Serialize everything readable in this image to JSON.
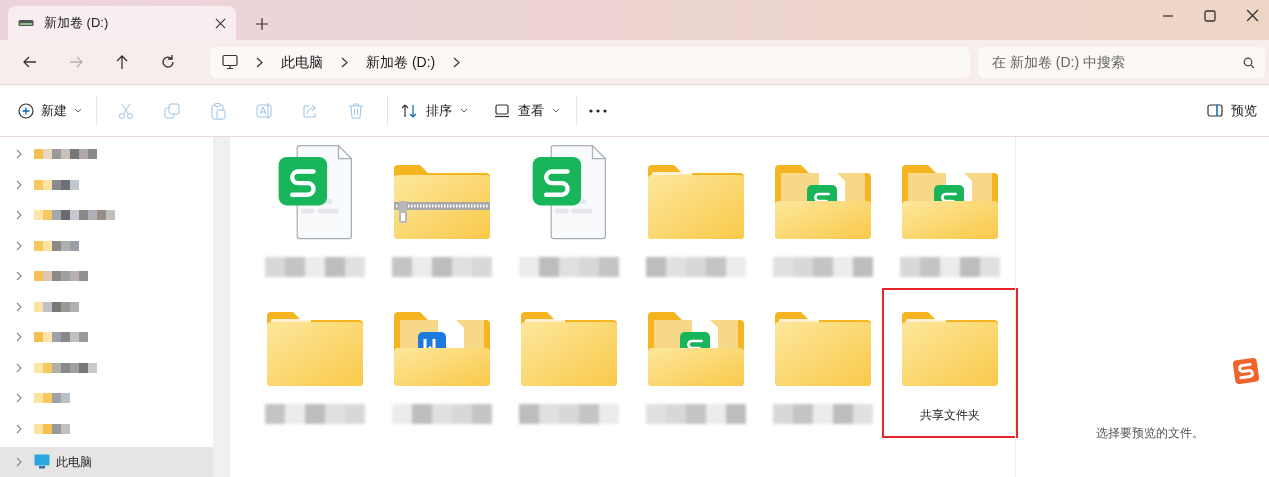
{
  "tab": {
    "title": "新加卷 (D:)"
  },
  "nav_buttons": [
    {
      "kind": "back",
      "disabled": false
    },
    {
      "kind": "forward",
      "disabled": true
    },
    {
      "kind": "up",
      "disabled": false
    },
    {
      "kind": "refresh",
      "disabled": false
    }
  ],
  "address": {
    "crumbs": [
      "此电脑",
      "新加卷 (D:)"
    ]
  },
  "search": {
    "placeholder": "在 新加卷 (D:) 中搜索"
  },
  "toolbar": {
    "new_label": "新建",
    "actions": [
      {
        "kind": "cut",
        "disabled": true
      },
      {
        "kind": "copy",
        "disabled": true
      },
      {
        "kind": "paste",
        "disabled": true
      },
      {
        "kind": "rename",
        "disabled": true
      },
      {
        "kind": "share",
        "disabled": true
      },
      {
        "kind": "delete",
        "disabled": true
      }
    ],
    "sort_label": "排序",
    "view_label": "查看",
    "preview_label": "预览"
  },
  "sidebar": {
    "items": [
      {
        "kind": "redacted",
        "selected": false
      },
      {
        "kind": "redacted",
        "selected": false
      },
      {
        "kind": "redacted",
        "selected": false
      },
      {
        "kind": "redacted",
        "selected": false
      },
      {
        "kind": "redacted",
        "selected": false
      },
      {
        "kind": "redacted",
        "selected": false
      },
      {
        "kind": "redacted",
        "selected": false
      },
      {
        "kind": "redacted",
        "selected": false
      },
      {
        "kind": "redacted",
        "selected": false
      },
      {
        "kind": "redacted",
        "selected": false
      },
      {
        "kind": "pc",
        "label": "此电脑",
        "selected": true
      }
    ]
  },
  "files": [
    {
      "kind": "sheet-file",
      "outlined": false
    },
    {
      "kind": "zip-folder",
      "outlined": false
    },
    {
      "kind": "sheet-file",
      "outlined": false
    },
    {
      "kind": "folder",
      "outlined": false
    },
    {
      "kind": "sheet-folder",
      "outlined": false
    },
    {
      "kind": "sheet-folder",
      "outlined": false
    },
    {
      "kind": "folder",
      "outlined": false
    },
    {
      "kind": "doc-folder",
      "outlined": false
    },
    {
      "kind": "folder",
      "outlined": false
    },
    {
      "kind": "sheet-folder",
      "outlined": false
    },
    {
      "kind": "folder",
      "outlined": false
    },
    {
      "kind": "folder",
      "label": "共享文件夹",
      "outlined": true
    }
  ],
  "preview_pane": {
    "message": "选择要预览的文件。"
  }
}
